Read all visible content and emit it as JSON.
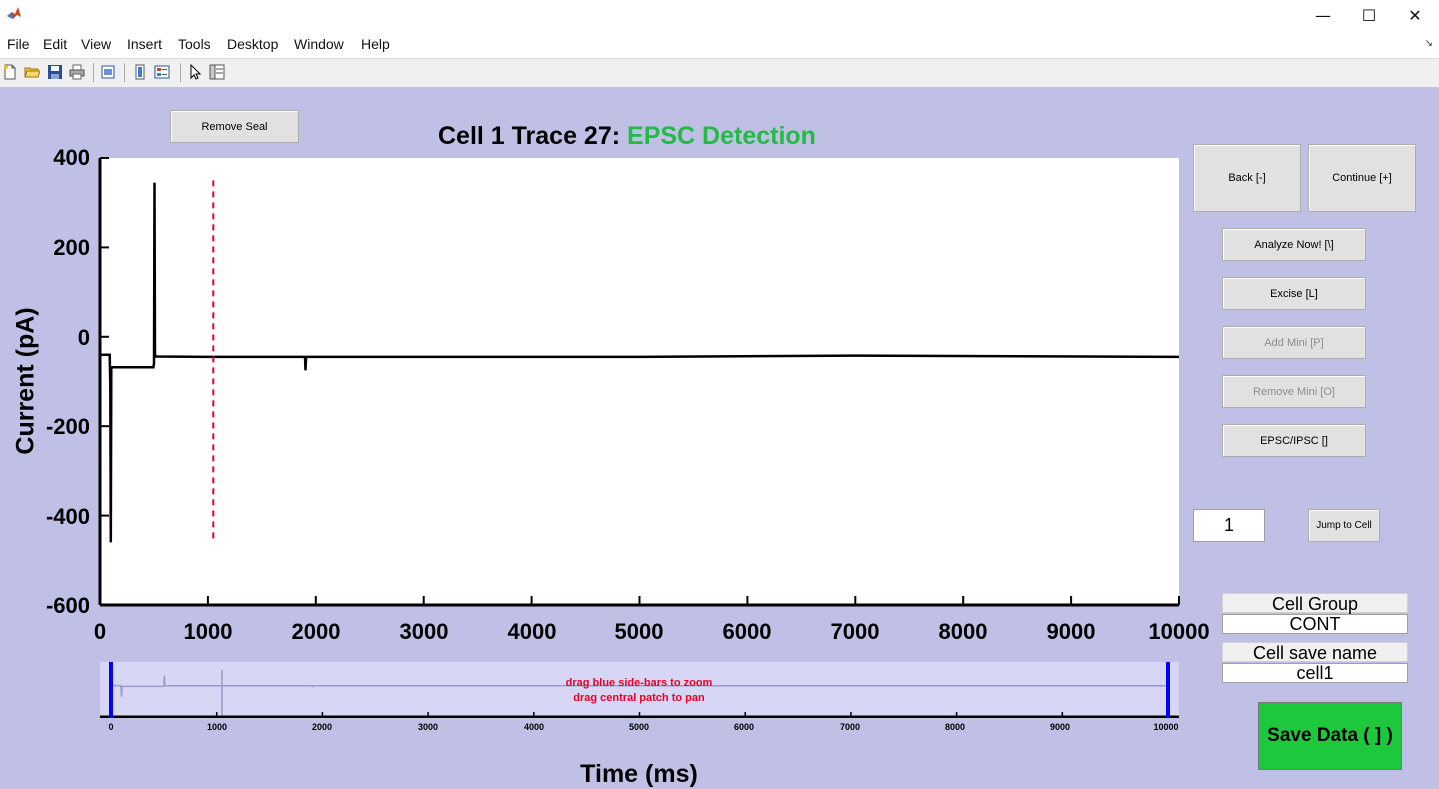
{
  "window": {
    "controls": {
      "minimize": "—",
      "maximize": "☐",
      "close": "✕"
    }
  },
  "menubar": {
    "items": [
      "File",
      "Edit",
      "View",
      "Insert",
      "Tools",
      "Desktop",
      "Window",
      "Help"
    ]
  },
  "toolbar": {
    "icons": [
      "new-file-icon",
      "open-folder-icon",
      "save-icon",
      "print-icon",
      "print-preview-icon",
      "colorbar-icon",
      "legend-icon",
      "pointer-icon",
      "property-editor-icon"
    ]
  },
  "buttons": {
    "remove_seal": "Remove Seal",
    "back": "Back [-]",
    "continue": "Continue [+]",
    "analyze": "Analyze Now! [\\]",
    "excise": "Excise [L]",
    "add_mini": "Add Mini [P]",
    "remove_mini": "Remove Mini [O]",
    "epsc_ipsc": "EPSC/IPSC []",
    "jump_to_cell": "Jump to Cell",
    "save_data": "Save Data ( ] )"
  },
  "plot": {
    "title_prefix": "Cell 1 Trace 27: ",
    "title_highlight": "EPSC Detection",
    "title_highlight_color": "#22bb44"
  },
  "chart_data": {
    "type": "line",
    "xlabel": "Time (ms)",
    "ylabel": "Current (pA)",
    "xlim": [
      0,
      10000
    ],
    "ylim": [
      -600,
      400
    ],
    "xticks": [
      0,
      1000,
      2000,
      3000,
      4000,
      5000,
      6000,
      7000,
      8000,
      9000,
      10000
    ],
    "yticks": [
      400,
      200,
      0,
      -200,
      -400,
      -600
    ],
    "grid": false,
    "series": [
      {
        "color": "#000000",
        "x": [
          0,
          90,
          95,
          100,
          105,
          110,
          120,
          495,
          500,
          505,
          510,
          515,
          520,
          1000,
          1900,
          1905,
          1910,
          3000,
          5000,
          7000,
          10000
        ],
        "y": [
          -40,
          -40,
          -110,
          -460,
          -70,
          -68,
          -68,
          -68,
          -60,
          345,
          -45,
          -42,
          -44,
          -45,
          -45,
          -75,
          -45,
          -45,
          -45,
          -42,
          -45
        ]
      }
    ],
    "annotations": [
      {
        "type": "vline",
        "x": 1050,
        "y_from": -460,
        "y_to": 350,
        "color": "#e8002a",
        "style": "dashed"
      }
    ]
  },
  "navigator": {
    "hint_line1": "drag blue side-bars to zoom",
    "hint_line2": "drag central patch to pan",
    "ticks": [
      0,
      1000,
      2000,
      3000,
      4000,
      5000,
      6000,
      7000,
      8000,
      9000,
      10000
    ],
    "zoom_range": [
      0,
      10000
    ],
    "bar_color": "#0000ff"
  },
  "cell_jump": {
    "value": "1"
  },
  "cell_group": {
    "label": "Cell Group",
    "value": "CONT"
  },
  "cell_save_name": {
    "label": "Cell save name",
    "value": "cell1"
  }
}
